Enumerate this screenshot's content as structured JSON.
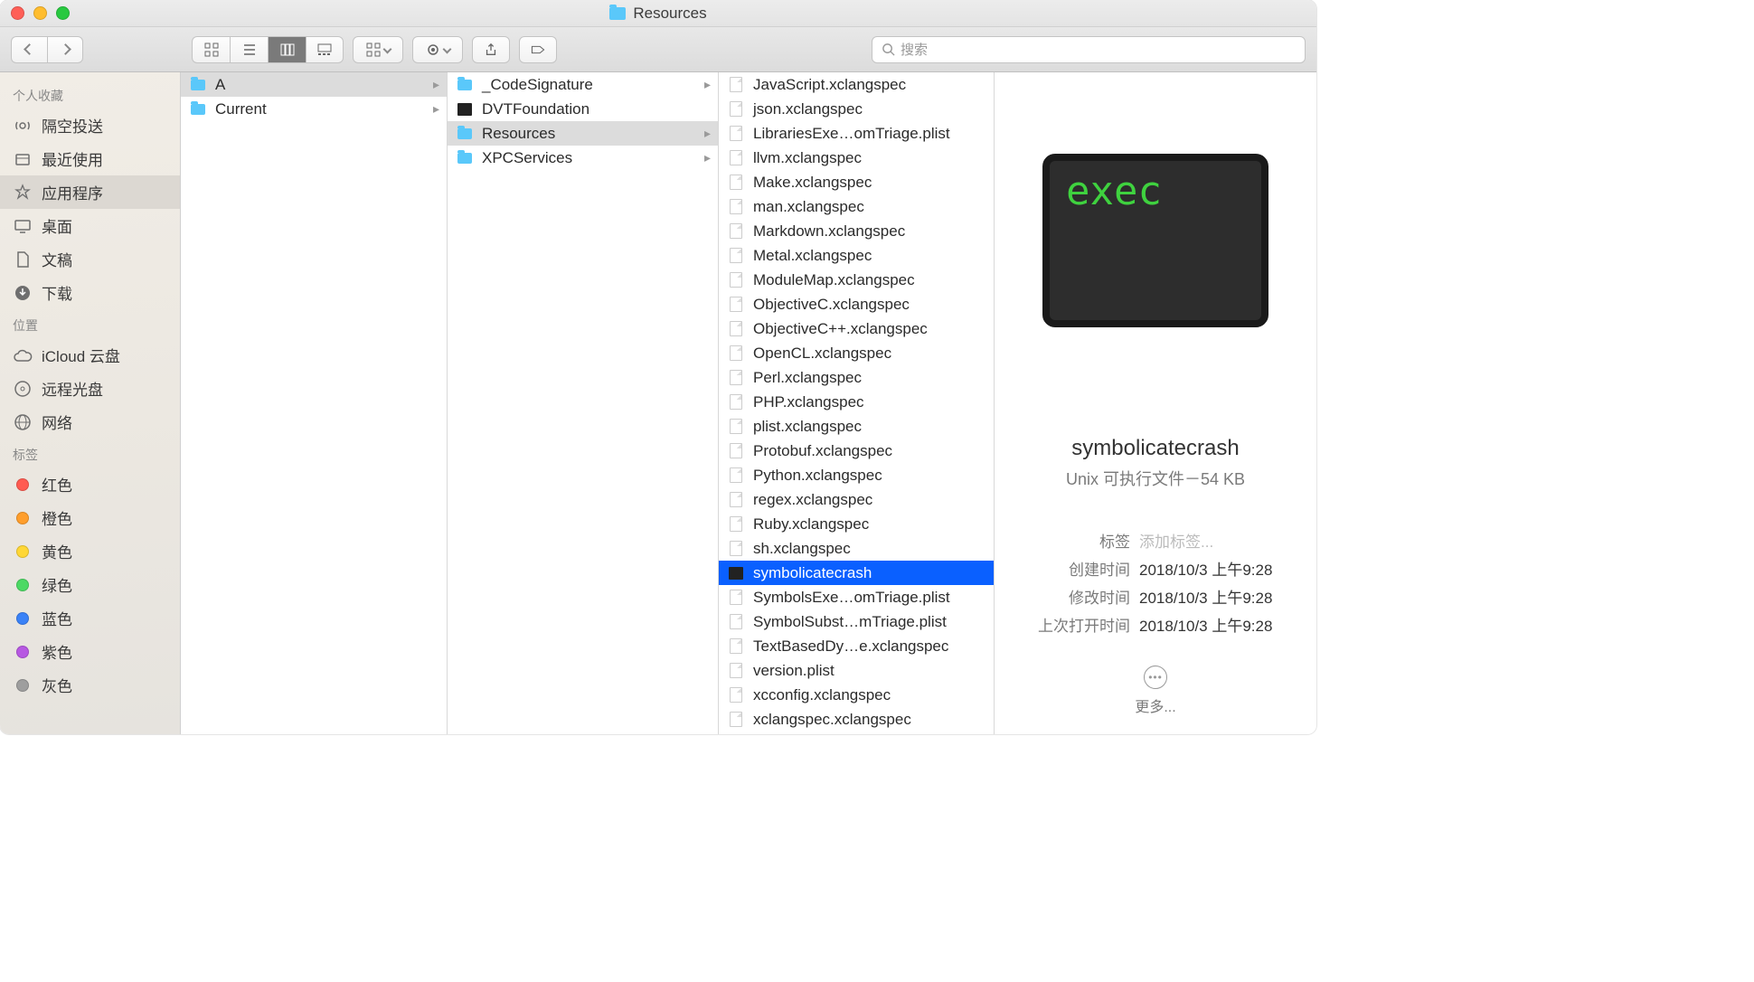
{
  "window": {
    "title": "Resources"
  },
  "toolbar": {
    "search_placeholder": "搜索"
  },
  "sidebar": {
    "sections": [
      {
        "header": "个人收藏",
        "items": [
          {
            "label": "隔空投送",
            "icon": "airdrop"
          },
          {
            "label": "最近使用",
            "icon": "recent"
          },
          {
            "label": "应用程序",
            "icon": "apps",
            "selected": true
          },
          {
            "label": "桌面",
            "icon": "desktop"
          },
          {
            "label": "文稿",
            "icon": "documents"
          },
          {
            "label": "下载",
            "icon": "downloads"
          }
        ]
      },
      {
        "header": "位置",
        "items": [
          {
            "label": "iCloud 云盘",
            "icon": "icloud"
          },
          {
            "label": "远程光盘",
            "icon": "disc"
          },
          {
            "label": "网络",
            "icon": "network"
          }
        ]
      },
      {
        "header": "标签",
        "items": [
          {
            "label": "红色",
            "color": "#ff5b51"
          },
          {
            "label": "橙色",
            "color": "#ff9e2c"
          },
          {
            "label": "黄色",
            "color": "#ffd736"
          },
          {
            "label": "绿色",
            "color": "#4cd964"
          },
          {
            "label": "蓝色",
            "color": "#3a82f7"
          },
          {
            "label": "紫色",
            "color": "#b758e2"
          },
          {
            "label": "灰色",
            "color": "#9e9e9e"
          }
        ]
      }
    ]
  },
  "columns": {
    "col1": [
      {
        "name": "A",
        "type": "folder",
        "selected": true,
        "hasChild": true
      },
      {
        "name": "Current",
        "type": "folder",
        "hasChild": true
      }
    ],
    "col2": [
      {
        "name": "_CodeSignature",
        "type": "folder",
        "hasChild": true
      },
      {
        "name": "DVTFoundation",
        "type": "exec"
      },
      {
        "name": "Resources",
        "type": "folder",
        "selected": true,
        "hasChild": true
      },
      {
        "name": "XPCServices",
        "type": "folder",
        "hasChild": true
      }
    ],
    "col3": [
      {
        "name": "JavaScript.xclangspec",
        "type": "file"
      },
      {
        "name": "json.xclangspec",
        "type": "file"
      },
      {
        "name": "LibrariesExe…omTriage.plist",
        "type": "plist"
      },
      {
        "name": "llvm.xclangspec",
        "type": "file"
      },
      {
        "name": "Make.xclangspec",
        "type": "file"
      },
      {
        "name": "man.xclangspec",
        "type": "file"
      },
      {
        "name": "Markdown.xclangspec",
        "type": "file"
      },
      {
        "name": "Metal.xclangspec",
        "type": "file"
      },
      {
        "name": "ModuleMap.xclangspec",
        "type": "file"
      },
      {
        "name": "ObjectiveC.xclangspec",
        "type": "file"
      },
      {
        "name": "ObjectiveC++.xclangspec",
        "type": "file"
      },
      {
        "name": "OpenCL.xclangspec",
        "type": "file"
      },
      {
        "name": "Perl.xclangspec",
        "type": "file"
      },
      {
        "name": "PHP.xclangspec",
        "type": "file"
      },
      {
        "name": "plist.xclangspec",
        "type": "file"
      },
      {
        "name": "Protobuf.xclangspec",
        "type": "file"
      },
      {
        "name": "Python.xclangspec",
        "type": "file"
      },
      {
        "name": "regex.xclangspec",
        "type": "file"
      },
      {
        "name": "Ruby.xclangspec",
        "type": "file"
      },
      {
        "name": "sh.xclangspec",
        "type": "file"
      },
      {
        "name": "symbolicatecrash",
        "type": "exec",
        "selected": true
      },
      {
        "name": "SymbolsExe…omTriage.plist",
        "type": "plist"
      },
      {
        "name": "SymbolSubst…mTriage.plist",
        "type": "plist"
      },
      {
        "name": "TextBasedDy…e.xclangspec",
        "type": "file"
      },
      {
        "name": "version.plist",
        "type": "file"
      },
      {
        "name": "xcconfig.xclangspec",
        "type": "file"
      },
      {
        "name": "xclangspec.xclangspec",
        "type": "file"
      }
    ]
  },
  "preview": {
    "exec_label": "exec",
    "name": "symbolicatecrash",
    "kind_size": "Unix 可执行文件－54 KB",
    "tags_label": "标签",
    "tags_placeholder": "添加标签...",
    "created_label": "创建时间",
    "created_value": "2018/10/3 上午9:28",
    "modified_label": "修改时间",
    "modified_value": "2018/10/3 上午9:28",
    "opened_label": "上次打开时间",
    "opened_value": "2018/10/3 上午9:28",
    "more_label": "更多..."
  }
}
